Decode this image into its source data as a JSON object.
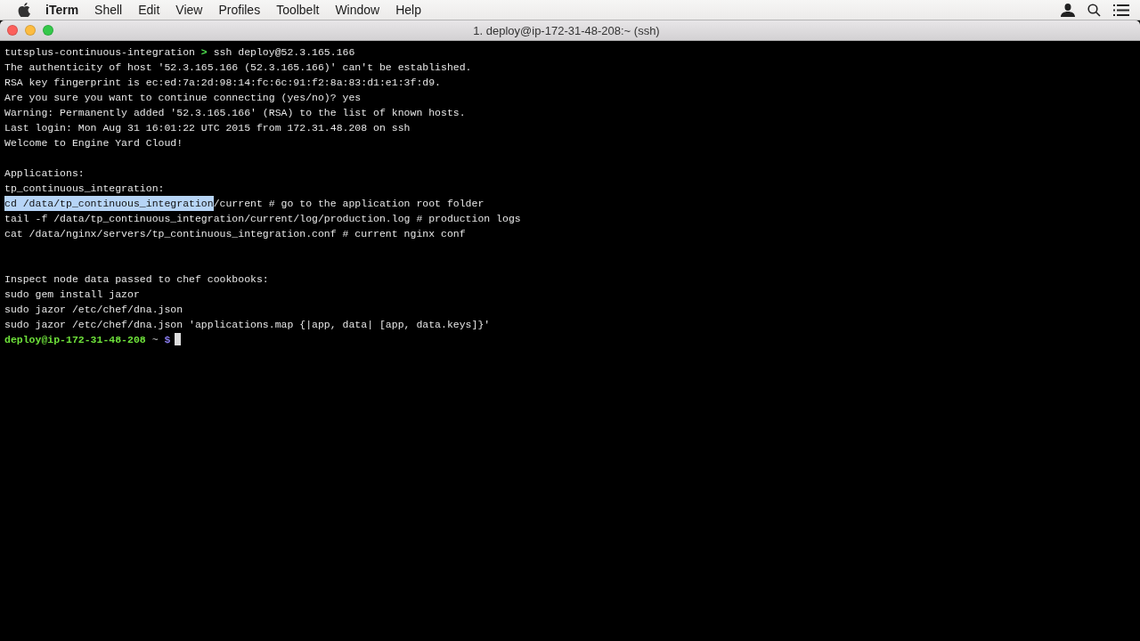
{
  "menu_bar": {
    "items": [
      {
        "label": "iTerm",
        "kind": "app"
      },
      {
        "label": "Shell",
        "kind": "menu"
      },
      {
        "label": "Edit",
        "kind": "menu"
      },
      {
        "label": "View",
        "kind": "menu"
      },
      {
        "label": "Profiles",
        "kind": "menu"
      },
      {
        "label": "Toolbelt",
        "kind": "menu"
      },
      {
        "label": "Window",
        "kind": "menu"
      },
      {
        "label": "Help",
        "kind": "menu"
      }
    ]
  },
  "window": {
    "title": "1. deploy@ip-172-31-48-208:~ (ssh)"
  },
  "terminal": {
    "lines": [
      {
        "segments": [
          {
            "kind": "text",
            "text": "tutsplus-continuous-integration "
          },
          {
            "kind": "arrow",
            "text": ">"
          },
          {
            "kind": "text",
            "text": " ssh deploy@52.3.165.166"
          }
        ]
      },
      {
        "segments": [
          {
            "kind": "text",
            "text": "The authenticity of host '52.3.165.166 (52.3.165.166)' can't be established."
          }
        ]
      },
      {
        "segments": [
          {
            "kind": "text",
            "text": "RSA key fingerprint is ec:ed:7a:2d:98:14:fc:6c:91:f2:8a:83:d1:e1:3f:d9."
          }
        ]
      },
      {
        "segments": [
          {
            "kind": "text",
            "text": "Are you sure you want to continue connecting (yes/no)? yes"
          }
        ]
      },
      {
        "segments": [
          {
            "kind": "text",
            "text": "Warning: Permanently added '52.3.165.166' (RSA) to the list of known hosts."
          }
        ]
      },
      {
        "segments": [
          {
            "kind": "text",
            "text": "Last login: Mon Aug 31 16:01:22 UTC 2015 from 172.31.48.208 on ssh"
          }
        ]
      },
      {
        "segments": [
          {
            "kind": "text",
            "text": "Welcome to Engine Yard Cloud!"
          }
        ]
      },
      {
        "kind": "blank"
      },
      {
        "segments": [
          {
            "kind": "text",
            "text": "Applications:"
          }
        ]
      },
      {
        "segments": [
          {
            "kind": "text",
            "text": "tp_continuous_integration:"
          }
        ]
      },
      {
        "segments": [
          {
            "kind": "selection",
            "text": "cd /data/tp_continuous_integration"
          },
          {
            "kind": "text",
            "text": "/current # go to the application root folder"
          }
        ]
      },
      {
        "segments": [
          {
            "kind": "text",
            "text": "tail -f /data/tp_continuous_integration/current/log/production.log # production logs"
          }
        ]
      },
      {
        "segments": [
          {
            "kind": "text",
            "text": "cat /data/nginx/servers/tp_continuous_integration.conf # current nginx conf"
          }
        ]
      },
      {
        "kind": "blank"
      },
      {
        "kind": "blank"
      },
      {
        "segments": [
          {
            "kind": "text",
            "text": "Inspect node data passed to chef cookbooks:"
          }
        ]
      },
      {
        "segments": [
          {
            "kind": "text",
            "text": "sudo gem install jazor"
          }
        ]
      },
      {
        "segments": [
          {
            "kind": "text",
            "text": "sudo jazor /etc/chef/dna.json"
          }
        ]
      },
      {
        "segments": [
          {
            "kind": "text",
            "text": "sudo jazor /etc/chef/dna.json 'applications.map {|app, data| [app, data.keys]}'"
          }
        ]
      },
      {
        "segments": [
          {
            "kind": "host",
            "text": "deploy@ip-172-31-48-208"
          },
          {
            "kind": "dir",
            "text": " ~ "
          },
          {
            "kind": "dollar",
            "text": "$"
          },
          {
            "kind": "cursor"
          }
        ]
      }
    ]
  }
}
